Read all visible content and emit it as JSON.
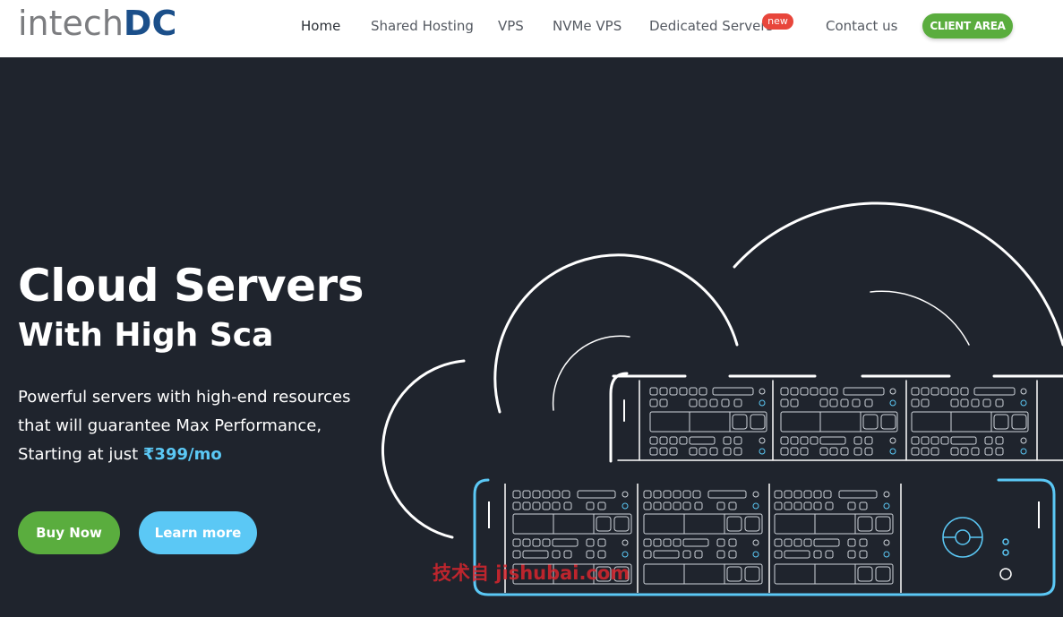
{
  "brand": {
    "logo_main": "intech",
    "logo_accent": "DC"
  },
  "nav": {
    "items": [
      {
        "label": "Home",
        "active": true
      },
      {
        "label": "Shared Hosting",
        "active": false
      },
      {
        "label": "VPS",
        "active": false
      },
      {
        "label": "NVMe VPS",
        "active": false
      },
      {
        "label": "Dedicated Servers",
        "active": false,
        "badge": "new"
      },
      {
        "label": "Contact us",
        "active": false
      }
    ],
    "client_area": "CLIENT AREA"
  },
  "hero": {
    "title": "Cloud Servers",
    "subtitle": "With High Sca",
    "description_before_price": "Powerful servers with high-end resources that will guarantee Max Performance, Starting at just ",
    "price": "₹399/mo",
    "buy_button": "Buy Now",
    "learn_button": "Learn more"
  },
  "watermark": "技术自 jishubai.com",
  "colors": {
    "nav_bg": "#ffffff",
    "hero_bg": "#1f242d",
    "green": "#5aad3e",
    "light_blue": "#5bc8f5",
    "badge_red": "#e8463b",
    "logo_blue": "#1b4f8a"
  },
  "icons": {
    "illustration": "cloud-server-rack-illustration"
  }
}
